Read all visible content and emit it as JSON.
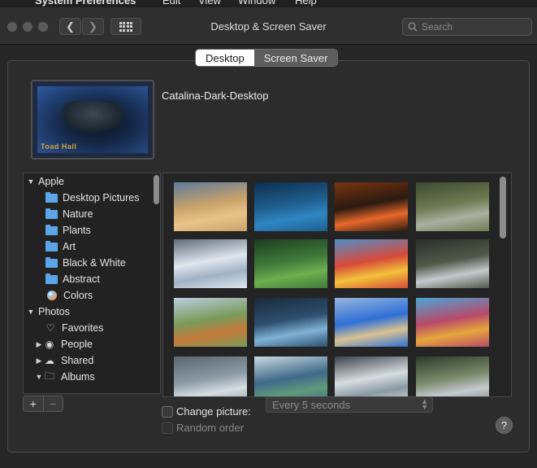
{
  "menubar": {
    "app": "System Preferences",
    "items": [
      "Edit",
      "View",
      "Window",
      "Help"
    ]
  },
  "window": {
    "title": "Desktop & Screen Saver",
    "search_placeholder": "Search"
  },
  "tabs": [
    {
      "label": "Desktop",
      "selected": true
    },
    {
      "label": "Screen Saver",
      "selected": false
    }
  ],
  "current_picture": {
    "name": "Catalina-Dark-Desktop",
    "signature": "Toad Hall"
  },
  "sidebar": {
    "apple_header": "Apple",
    "apple_items": [
      "Desktop Pictures",
      "Nature",
      "Plants",
      "Art",
      "Black & White",
      "Abstract",
      "Colors"
    ],
    "photos_header": "Photos",
    "photos_items": [
      "Favorites",
      "People",
      "Shared",
      "Albums"
    ]
  },
  "thumbnails": [
    {
      "colors": [
        "#c9a26a",
        "#e8c48a",
        "#5d7a9e"
      ]
    },
    {
      "colors": [
        "#1f5e8e",
        "#2f86c2",
        "#0d2e4d"
      ]
    },
    {
      "colors": [
        "#2a1a10",
        "#e8682a",
        "#7a3410"
      ]
    },
    {
      "colors": [
        "#6e7a52",
        "#aab0a0",
        "#3b4a30"
      ]
    },
    {
      "colors": [
        "#dfe6ee",
        "#9fb2c4",
        "#5e6b7a"
      ]
    },
    {
      "colors": [
        "#3f7a3a",
        "#6eaf4f",
        "#1d3d1f"
      ]
    },
    {
      "colors": [
        "#d84a3a",
        "#f2c23a",
        "#4f8ec9"
      ]
    },
    {
      "colors": [
        "#4f5a4a",
        "#c4c9cc",
        "#2a2f2a"
      ]
    },
    {
      "colors": [
        "#7a9a5a",
        "#c47a3a",
        "#b9cde0"
      ]
    },
    {
      "colors": [
        "#2d4f6e",
        "#7fb2d6",
        "#1a2a3a"
      ]
    },
    {
      "colors": [
        "#2f6fd6",
        "#d9c292",
        "#96b6de"
      ]
    },
    {
      "colors": [
        "#b84a6a",
        "#e6a63a",
        "#4aa6d6"
      ]
    },
    {
      "colors": [
        "#8a9aa6",
        "#d5dde2",
        "#5a6670"
      ]
    },
    {
      "colors": [
        "#3f6a8a",
        "#5f9a7a",
        "#c9d9e0"
      ]
    },
    {
      "colors": [
        "#d6dde2",
        "#8a9aa2",
        "#3a4248"
      ]
    },
    {
      "colors": [
        "#7a8a6a",
        "#c4cad0",
        "#2a3a2a"
      ]
    }
  ],
  "controls": {
    "add_label": "+",
    "remove_label": "−",
    "change_picture_label": "Change picture:",
    "interval_value": "Every 5 seconds",
    "random_order_label": "Random order",
    "help_label": "?"
  }
}
